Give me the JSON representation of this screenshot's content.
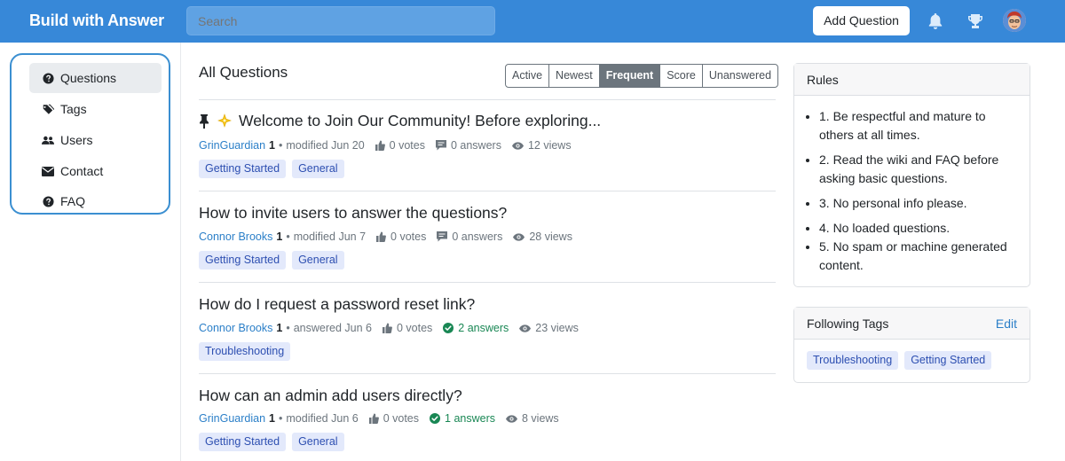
{
  "header": {
    "brand": "Build with Answer",
    "search_placeholder": "Search",
    "add_question_label": "Add Question"
  },
  "sidebar": {
    "items": [
      {
        "label": "Questions",
        "icon": "question-circle-icon",
        "active": true
      },
      {
        "label": "Tags",
        "icon": "tags-icon",
        "active": false
      },
      {
        "label": "Users",
        "icon": "users-icon",
        "active": false
      },
      {
        "label": "Contact",
        "icon": "envelope-icon",
        "active": false
      },
      {
        "label": "FAQ",
        "icon": "question-circle-icon",
        "active": false
      }
    ]
  },
  "main": {
    "title": "All Questions",
    "filters": [
      "Active",
      "Newest",
      "Frequent",
      "Score",
      "Unanswered"
    ],
    "selected_filter": "Frequent",
    "questions": [
      {
        "prefix_icons": [
          "pin-icon",
          "sparkle-icon"
        ],
        "title": "Welcome to Join Our Community! Before exploring...",
        "author": "GrinGuardian",
        "reputation": "1",
        "action": "modified Jun 20",
        "votes": "0 votes",
        "answers": "0 answers",
        "answered": false,
        "views": "12 views",
        "tags": [
          "Getting Started",
          "General"
        ]
      },
      {
        "prefix_icons": [],
        "title": "How to invite users to answer the questions?",
        "author": "Connor Brooks",
        "reputation": "1",
        "action": "modified Jun 7",
        "votes": "0 votes",
        "answers": "0 answers",
        "answered": false,
        "views": "28 views",
        "tags": [
          "Getting Started",
          "General"
        ]
      },
      {
        "prefix_icons": [],
        "title": "How do I request a password reset link?",
        "author": "Connor Brooks",
        "reputation": "1",
        "action": "answered Jun 6",
        "votes": "0 votes",
        "answers": "2 answers",
        "answered": true,
        "views": "23 views",
        "tags": [
          "Troubleshooting"
        ]
      },
      {
        "prefix_icons": [],
        "title": "How can an admin add users directly?",
        "author": "GrinGuardian",
        "reputation": "1",
        "action": "modified Jun 6",
        "votes": "0 votes",
        "answers": "1 answers",
        "answered": true,
        "views": "8 views",
        "tags": [
          "Getting Started",
          "General"
        ]
      }
    ]
  },
  "rules_card": {
    "title": "Rules",
    "items": [
      "1. Be respectful and mature to others at all times.",
      "2. Read the wiki and FAQ before asking basic questions.",
      "3. No personal info please.",
      "4. No loaded questions.",
      "5. No spam or machine generated content."
    ]
  },
  "following_tags_card": {
    "title": "Following Tags",
    "edit_label": "Edit",
    "tags": [
      "Troubleshooting",
      "Getting Started"
    ]
  },
  "colors": {
    "header_bg": "#3788d8",
    "link": "#2b7fc8",
    "answered_green": "#198754",
    "tag_bg": "#e3e9fb",
    "tag_text": "#2d4fb1",
    "sidebar_highlight": "#3b8fd1"
  }
}
